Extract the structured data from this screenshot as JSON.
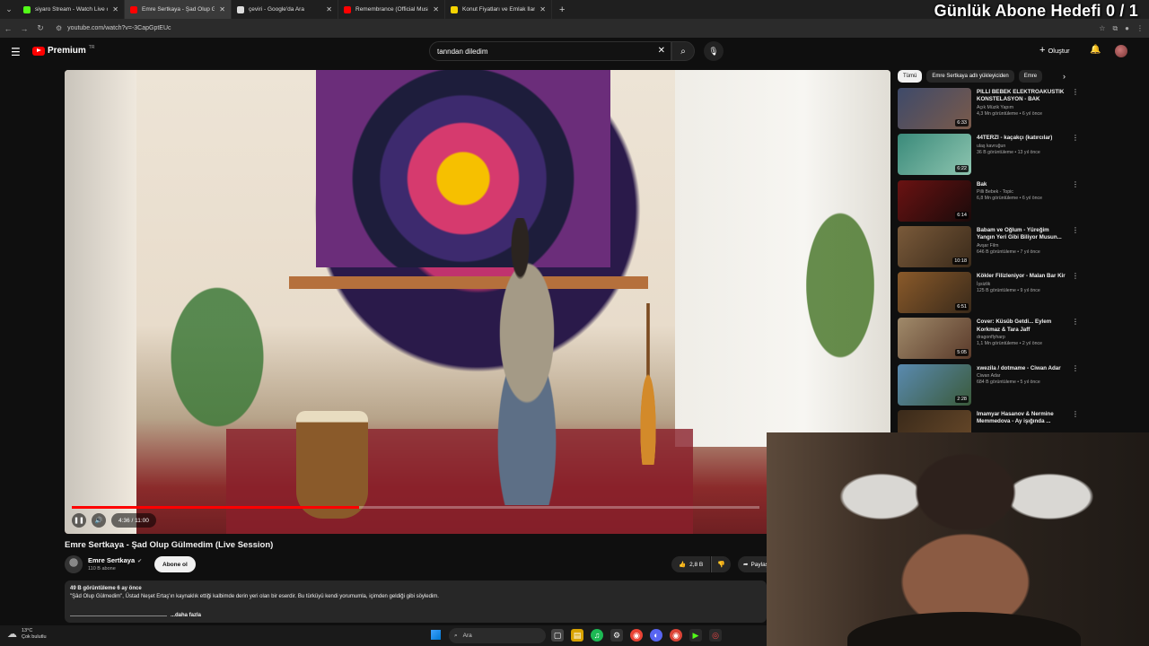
{
  "browser": {
    "tabs": [
      {
        "title": "siyaro Stream - Watch Live on Kick",
        "color": "#53fc18",
        "active": false
      },
      {
        "title": "Emre Sertkaya - Şad Olup Gülmedim",
        "color": "#ff0000",
        "active": true
      },
      {
        "title": "çeviri - Google'da Ara",
        "color": "#dddddd",
        "active": false
      },
      {
        "title": "Remembrance (Official Music Video)",
        "color": "#ff0000",
        "active": false
      },
      {
        "title": "Konut Fiyatları ve Emlak İlanları",
        "color": "#f5d300",
        "active": false
      }
    ],
    "new_tab": "+",
    "url": "youtube.com/watch?v=-3CapGptEUc"
  },
  "overlay_title": "Günlük Abone Hedefi 0 / 1",
  "youtube": {
    "logo_word": "Premium",
    "logo_region": "TR",
    "search_value": "tanndan diledim",
    "create_label": "Oluştur"
  },
  "player": {
    "current_time": "4:36",
    "duration": "11:00",
    "time_display": "4:36 / 11:00",
    "progress_fraction": 0.418
  },
  "video": {
    "title": "Emre Sertkaya - Şad Olup Gülmedim (Live Session)",
    "channel_name": "Emre Sertkaya",
    "channel_subs": "110 B abone",
    "subscribe_label": "Abone ol",
    "likes": "2,8 B",
    "share_label": "Paylaş",
    "views_date": "49 B görüntüleme  6 ay önce",
    "description": "\"Şâd Olup Gülmedim\", Üstad Neşet Ertaş'ın kaynaklık ettiği kalbimde derin yeri olan bir eserdir. Bu türküyü kendi yorumumla, içimden geldiği gibi söyledim.",
    "more_label": "...daha fazla"
  },
  "sidebar": {
    "chips": [
      {
        "label": "Tümü",
        "active": true
      },
      {
        "label": "Emre Sertkaya adlı yükleyiciden",
        "active": false
      },
      {
        "label": "Emre",
        "active": false
      }
    ],
    "recommendations": [
      {
        "title": "PİLLİ BEBEK ELEKTROAKUSTİK KONSTELASYON - BAK",
        "channel": "Açık Müzik Yapım",
        "meta": "4,3 Mn görüntüleme • 6 yıl önce",
        "duration": "6:33",
        "colors": [
          "#3e4a6a",
          "#7a5a4a"
        ]
      },
      {
        "title": "44TERZİ - kaçakçı (katırcılar)",
        "channel": "ulaş kavruğun",
        "meta": "36 B görüntüleme • 13 yıl önce",
        "duration": "6:22",
        "colors": [
          "#3a8a7a",
          "#8ec5b0"
        ]
      },
      {
        "title": "Bak",
        "channel": "Pilli Bebek - Topic",
        "meta": "6,8 Mn görüntüleme • 6 yıl önce",
        "duration": "6:14",
        "colors": [
          "#6a1212",
          "#1a0a0a"
        ]
      },
      {
        "title": "Babam ve Oğlum - Yüreğim Yangın Yeri Gibi Biliyor Musun...",
        "channel": "Avşar Film",
        "meta": "646 B görüntüleme • 7 yıl önce",
        "duration": "10:18",
        "colors": [
          "#7a5a3a",
          "#3a2a1a"
        ]
      },
      {
        "title": "Kökler Filizleniyor - Malan Bar Kir",
        "channel": "İşsizlik",
        "meta": "125 B görüntüleme • 9 yıl önce",
        "duration": "6:51",
        "colors": [
          "#8a5a2a",
          "#3a2a1a"
        ]
      },
      {
        "title": "Cover: Küsüb Getdi... Eylem Korkmaz & Tara Jaff",
        "channel": "dragonflyharp",
        "meta": "1,1 Mn görüntüleme • 2 yıl önce",
        "duration": "5:05",
        "colors": [
          "#a08a6a",
          "#5a3a2a"
        ]
      },
      {
        "title": "xwezila / dotmame - Ciwan Adar",
        "channel": "Ciwan Adar",
        "meta": "684 B görüntüleme • 5 yıl önce",
        "duration": "2:28",
        "colors": [
          "#5a8ab0",
          "#3a5a3a"
        ]
      },
      {
        "title": "İmamyar Hasanov & Nermine Memmedova - Ay işığında ...",
        "channel": "",
        "meta": "",
        "duration": "",
        "colors": [
          "#3a2a1a",
          "#6a4a2a"
        ]
      }
    ]
  },
  "taskbar": {
    "temp": "13°C",
    "weather": "Çok bulutlu",
    "search_placeholder": "Ara"
  }
}
